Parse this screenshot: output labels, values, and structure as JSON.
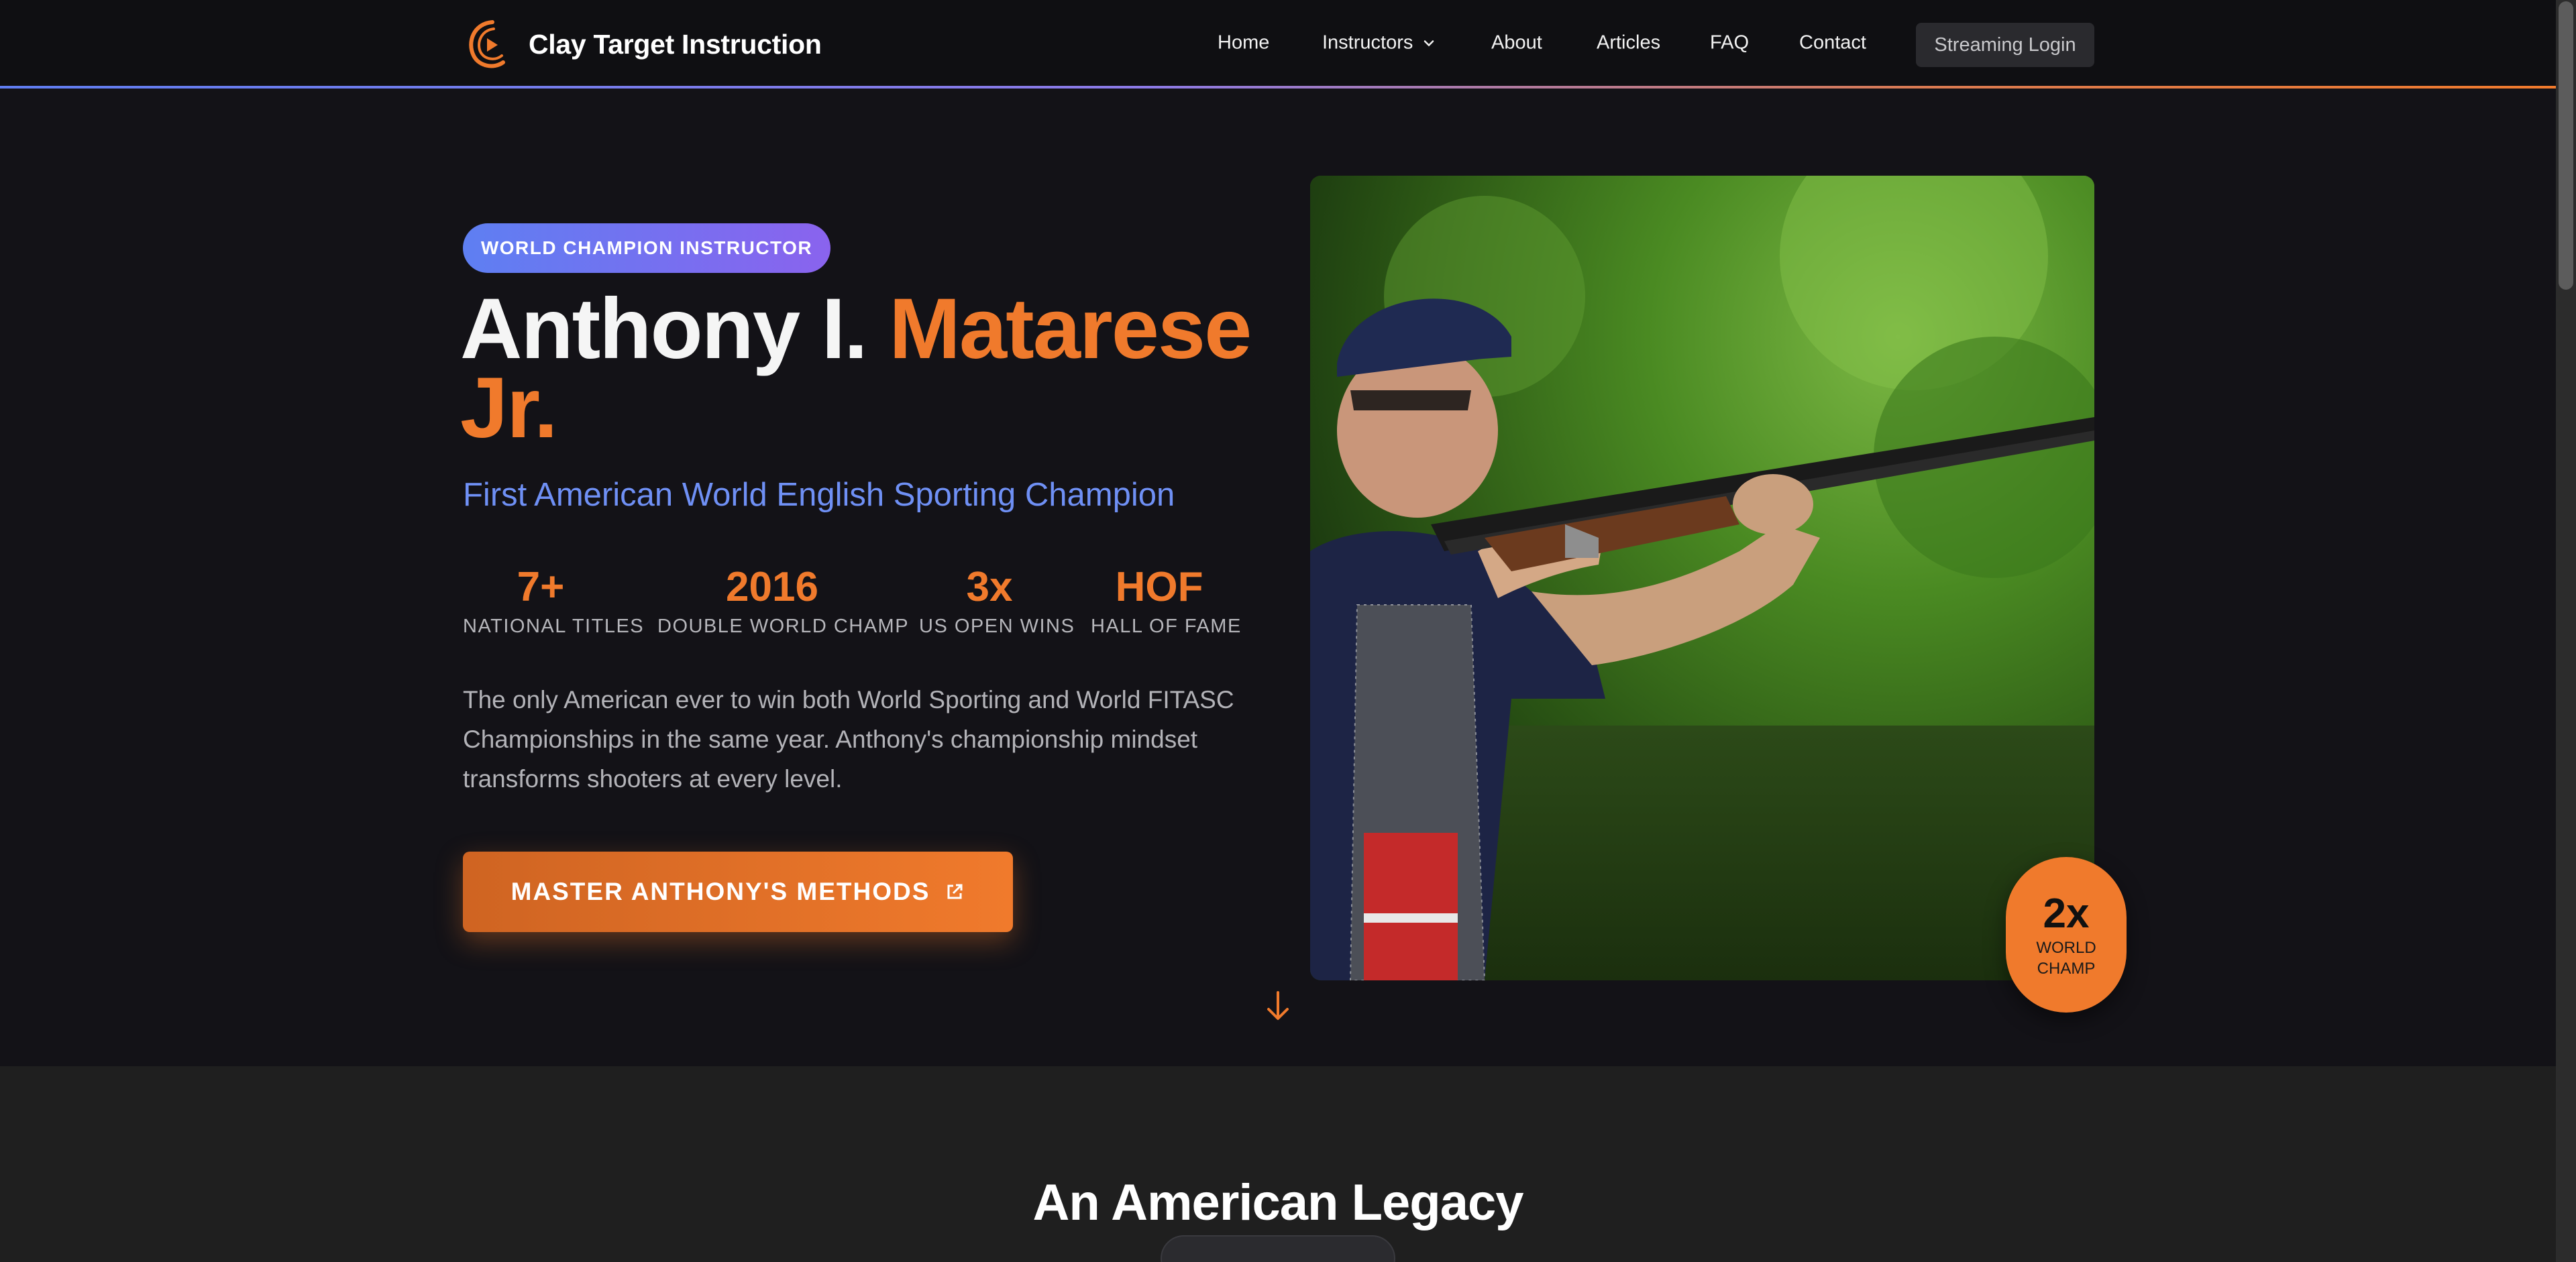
{
  "header": {
    "brand": "Clay Target Instruction",
    "nav": [
      "Home",
      "Instructors",
      "About",
      "Articles",
      "FAQ",
      "Contact"
    ],
    "login": "Streaming Login"
  },
  "hero": {
    "badge": "WORLD CHAMPION INSTRUCTOR",
    "name_first": "Anthony I.",
    "name_last": "Matarese Jr.",
    "tagline": "First American World English Sporting Champion",
    "stats": [
      {
        "value": "7+",
        "label": "NATIONAL TITLES"
      },
      {
        "value": "2016",
        "label": "DOUBLE WORLD CHAMP"
      },
      {
        "value": "3x",
        "label": "US OPEN WINS"
      },
      {
        "value": "HOF",
        "label": "HALL OF FAME"
      }
    ],
    "description": "The only American ever to win both World Sporting and World FITASC Championships in the same year. Anthony's championship mindset transforms shooters at every level.",
    "cta": "MASTER ANTHONY'S METHODS",
    "champ_badge": {
      "big": "2x",
      "line1": "WORLD",
      "line2": "CHAMP"
    }
  },
  "legacy": {
    "title": "An American Legacy"
  },
  "colors": {
    "accent": "#f07a2c",
    "blue": "#6f90f5",
    "background": "#131217"
  }
}
